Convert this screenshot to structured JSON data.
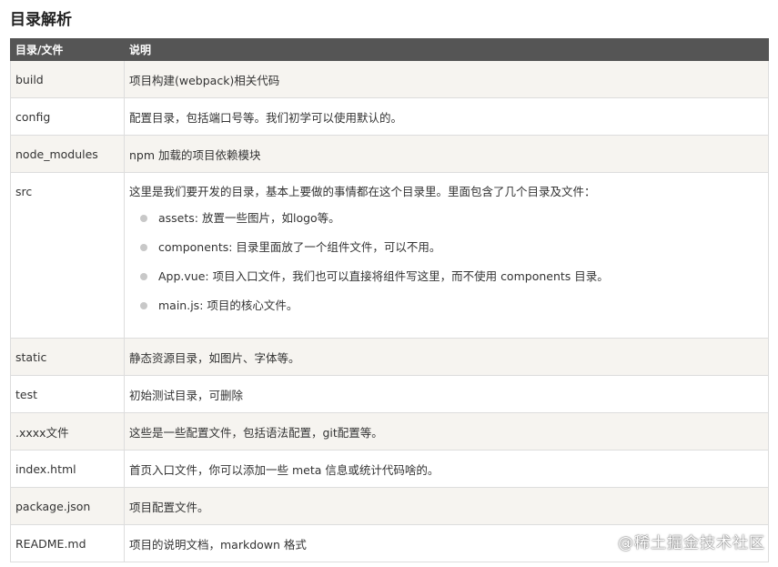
{
  "title": "目录解析",
  "table": {
    "headers": [
      "目录/文件",
      "说明"
    ],
    "rows": [
      {
        "name": "build",
        "desc": "项目构建(webpack)相关代码"
      },
      {
        "name": "config",
        "desc": "配置目录，包括端口号等。我们初学可以使用默认的。"
      },
      {
        "name": "node_modules",
        "desc": "npm 加载的项目依赖模块"
      },
      {
        "name": "src",
        "desc": "这里是我们要开发的目录，基本上要做的事情都在这个目录里。里面包含了几个目录及文件："
      },
      {
        "name": "static",
        "desc": "静态资源目录，如图片、字体等。"
      },
      {
        "name": "test",
        "desc": "初始测试目录，可删除"
      },
      {
        "name": ".xxxx文件",
        "desc": "这些是一些配置文件，包括语法配置，git配置等。"
      },
      {
        "name": "index.html",
        "desc": "首页入口文件，你可以添加一些 meta 信息或统计代码啥的。"
      },
      {
        "name": "package.json",
        "desc": "项目配置文件。"
      },
      {
        "name": "README.md",
        "desc": "项目的说明文档，markdown 格式"
      }
    ],
    "src_items": [
      "assets: 放置一些图片，如logo等。",
      "components: 目录里面放了一个组件文件，可以不用。",
      "App.vue: 项目入口文件，我们也可以直接将组件写这里，而不使用 components 目录。",
      "main.js: 项目的核心文件。"
    ]
  },
  "watermark": "@稀土掘金技术社区",
  "colors": {
    "header_bg": "#555555",
    "stripe_bg": "#f6f4f0",
    "border": "#dddddd",
    "bullet": "#c8c8c8"
  }
}
